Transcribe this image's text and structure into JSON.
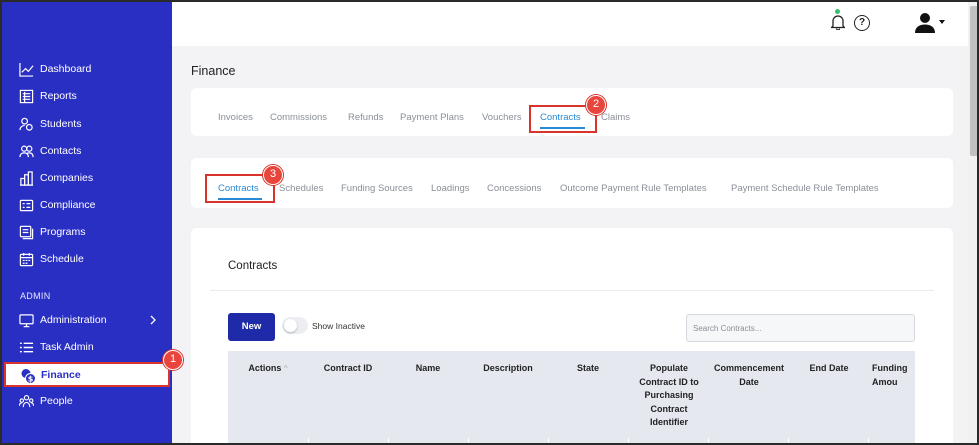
{
  "sidebar": {
    "items": [
      {
        "label": "Dashboard",
        "icon": "chart-line-icon"
      },
      {
        "label": "Reports",
        "icon": "report-icon"
      },
      {
        "label": "Students",
        "icon": "students-icon"
      },
      {
        "label": "Contacts",
        "icon": "contacts-icon"
      },
      {
        "label": "Companies",
        "icon": "companies-icon"
      },
      {
        "label": "Compliance",
        "icon": "compliance-icon"
      },
      {
        "label": "Programs",
        "icon": "programs-icon"
      },
      {
        "label": "Schedule",
        "icon": "calendar-icon"
      }
    ],
    "admin_heading": "ADMIN",
    "admin_items": [
      {
        "label": "Administration",
        "icon": "monitor-icon"
      },
      {
        "label": "Task Admin",
        "icon": "list-icon"
      },
      {
        "label": "Finance",
        "icon": "finance-icon",
        "active": true
      },
      {
        "label": "People",
        "icon": "people-icon"
      }
    ],
    "bg_color": "#2a2fc4"
  },
  "topbar": {
    "help_glyph": "?"
  },
  "page": {
    "title": "Finance"
  },
  "finance_tabs": [
    "Invoices",
    "Commissions",
    "Refunds",
    "Payment Plans",
    "Vouchers",
    "Contracts",
    "Claims"
  ],
  "finance_active_tab": "Contracts",
  "contract_tabs": [
    "Contracts",
    "Schedules",
    "Funding Sources",
    "Loadings",
    "Concessions",
    "Outcome Payment Rule Templates",
    "Payment Schedule Rule Templates"
  ],
  "contract_active_tab": "Contracts",
  "annotations": [
    "1",
    "2",
    "3"
  ],
  "contracts": {
    "title": "Contracts",
    "new_label": "New",
    "show_inactive_label": "Show Inactive",
    "show_inactive": false,
    "search_placeholder": "Search Contracts...",
    "sort_arrow": "^",
    "columns": [
      "Actions",
      "Contract ID",
      "Name",
      "Description",
      "State",
      "Populate Contract ID to Purchasing Contract Identifier",
      "Commencement Date",
      "End Date",
      "Funding Amou"
    ]
  },
  "colors": {
    "accent": "#1f2aa8",
    "active_tab": "#2a8ad4",
    "annotation": "#e8453c"
  }
}
